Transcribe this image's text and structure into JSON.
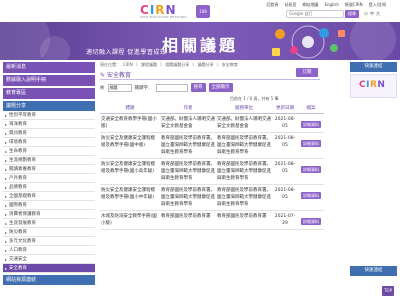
{
  "logo": {
    "letters": [
      "C",
      "I",
      "R",
      "N"
    ],
    "sub": "CIRN EDUCATION NETWORK",
    "badge": "108"
  },
  "top_links": [
    "回首頁",
    "站長室",
    "網站地圖",
    "English",
    "帳號CIRN",
    "登入/註冊"
  ],
  "search": {
    "placeholder": "Google 自訂",
    "button": "搜尋"
  },
  "font_size": [
    "小",
    "中",
    "大"
  ],
  "banner": {
    "title": "相關議題",
    "slogan": "適切融入課程  促進學習成效"
  },
  "sidebar": {
    "buttons": [
      "最新消息",
      "數據融入說明手冊",
      "教育專區"
    ],
    "section": "議題分享",
    "items": [
      "性別平等教育",
      "海洋教育",
      "資訊教育",
      "環境教育",
      "生命教育",
      "生涯規劃教育",
      "閱讀素養教育",
      "戶外教育",
      "品德教育",
      "全國基礎教育",
      "國際教育",
      "消費者保護教育",
      "生涯發展教育",
      "防災教育",
      "多元文化教育",
      "人口教育",
      "交通安全",
      "安全教育"
    ],
    "active_index": 17,
    "bottom": "網站資源連結"
  },
  "breadcrumb": [
    "現在位置：",
    "CIRN",
    "〉 課程議題",
    "〉 相關議題分享",
    "〉 議題分享",
    "〉 安全教育"
  ],
  "main": {
    "title": "安全教育",
    "subscribe": "訂閱"
  },
  "filter": {
    "label_field": "依",
    "field_value": "標題",
    "label_kw": "關鍵字：",
    "search_btn": "搜尋",
    "all_btn": "全部顯示"
  },
  "pagination": "目前在 1 / 6 頁，共有 5 筆",
  "table": {
    "headers": [
      "標題",
      "作者",
      "服務單位",
      "更新日期",
      "檔案"
    ],
    "rows": [
      {
        "title": "交通安全教育教學手冊(國小版)",
        "author": "交通部。財團法人陽明交通安全文教基金會",
        "unit": "交通部。財團法人陽明交通安全文教基金會",
        "date": "2021-08-05",
        "file": "詳細資料"
      },
      {
        "title": "防災安全及健康安全課程模組及教學手冊(國中版)",
        "author": "教育部國民及學前教育署。國立臺灣師範大學健康促進與衛生教育學系",
        "unit": "教育部國民及學前教育署。國立臺灣師範大學健康促進與衛生教育學系",
        "date": "2021-08-05",
        "file": "詳細資料"
      },
      {
        "title": "防災安全及健康安全課程模組及教學手冊(國小高年級)",
        "author": "教育部國民及學前教育署。國立臺灣師範大學健康促進與衛生教育學系",
        "unit": "教育部國民及學前教育署。國立臺灣師範大學健康促進與衛生教育學系",
        "date": "2021-08-05",
        "file": "詳細資料"
      },
      {
        "title": "防災安全及健康安全課程模組及教學手冊(國小中年級)",
        "author": "教育部國民及學前教育署。國立臺灣師範大學健康促進與衛生教育學系",
        "unit": "教育部國民及學前教育署。國立臺灣師範大學健康促進與衛生教育學系",
        "date": "2021-08-05",
        "file": "詳細資料"
      },
      {
        "title": "水域及防溺安全教學手冊(國小版)",
        "author": "教育部國民及學前教育署",
        "unit": "教育部國民及學前教育署",
        "date": "2021-07-29",
        "file": "詳細資料"
      }
    ]
  },
  "right": {
    "head": "快速連結",
    "card_letters": [
      "C",
      "I",
      "R",
      "N"
    ],
    "section": "快速連結"
  },
  "top_button": "TOP",
  "colors": {
    "purple": "#6b4aa8",
    "blue": "#3f6fb0",
    "accent": "#8d63c9"
  }
}
